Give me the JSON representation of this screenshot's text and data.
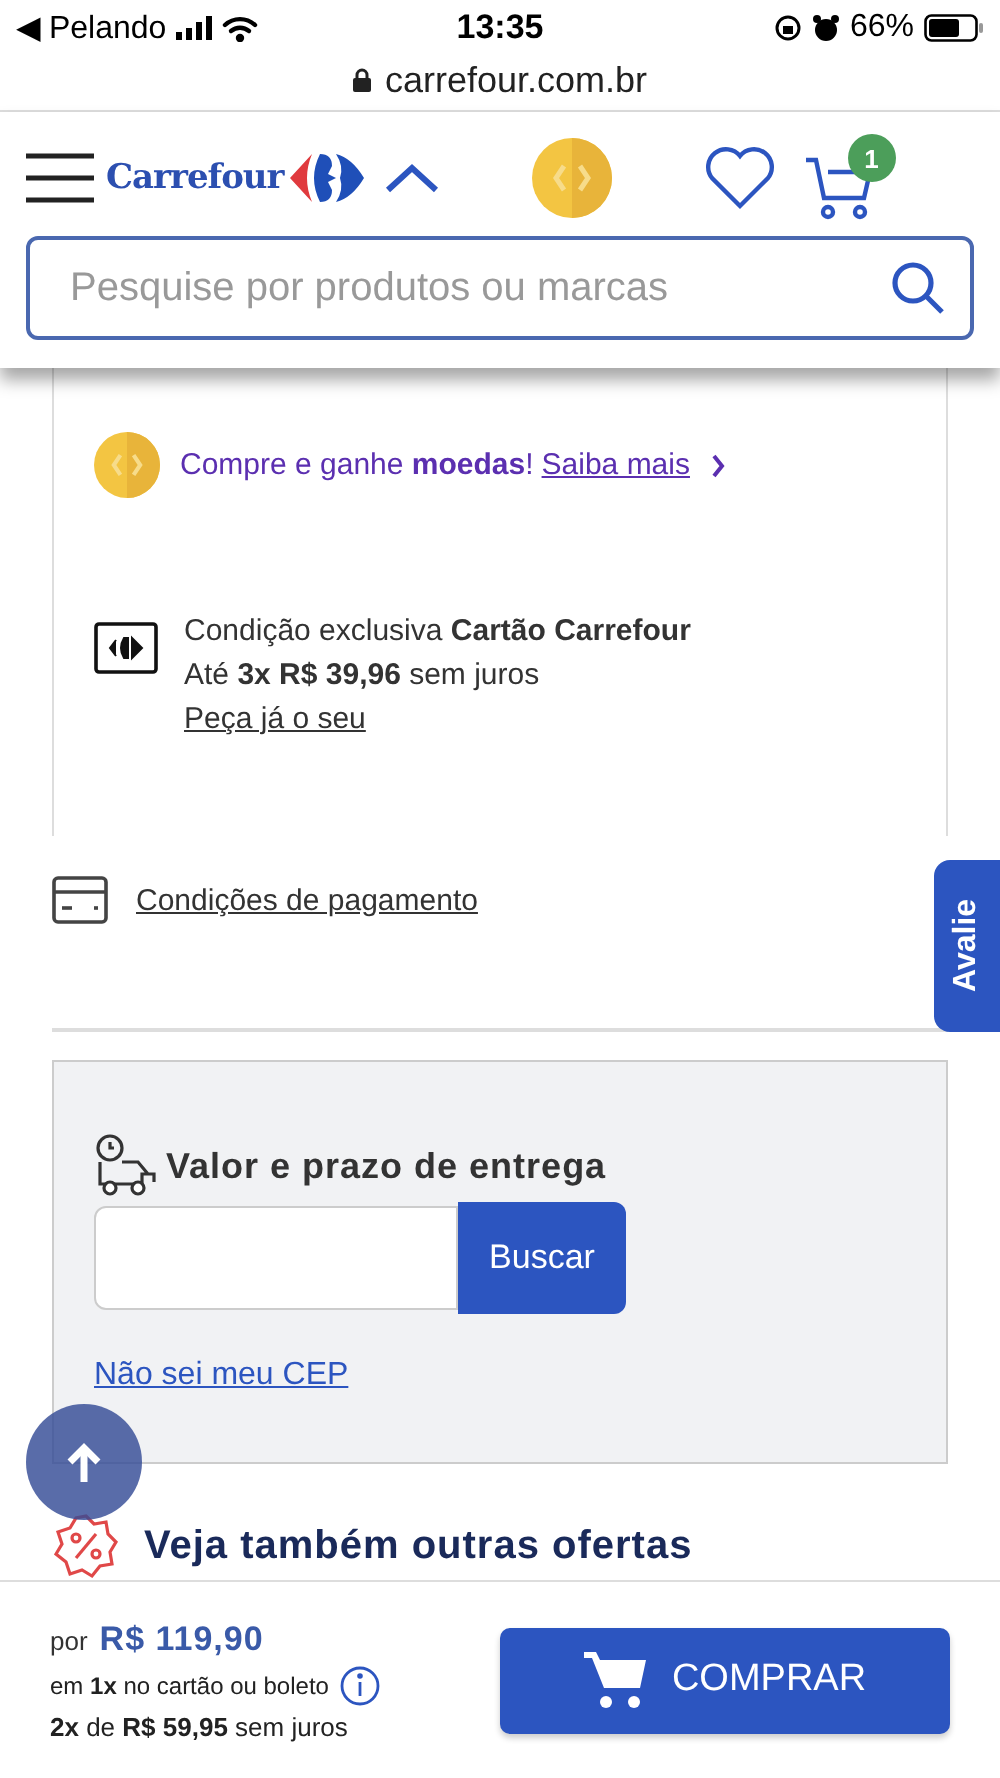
{
  "status_bar": {
    "back_app": "◀ Pelando",
    "time": "13:35",
    "battery": "66%"
  },
  "url_bar": {
    "url": "carrefour.com.br"
  },
  "header": {
    "logo": "Carrefour",
    "cart_count": "1"
  },
  "search": {
    "placeholder": "Pesquise por produtos ou marcas"
  },
  "coins": {
    "text": "Compre e ganhe **moedas**!",
    "link": "Saiba mais"
  },
  "card_offer": {
    "line_1": "Condição exclusiva **Cartão Carrefour**",
    "line_2": "Até **3x R$ 39,96** sem juros",
    "link": "Peça já o seu"
  },
  "payment": {
    "link": "Condições de pagamento"
  },
  "feedback_tab": {
    "label": "Avalie"
  },
  "delivery": {
    "title": "Valor e prazo de entrega",
    "button": "Buscar",
    "link": "Não sei meu CEP"
  },
  "offers": {
    "title": "Veja também outras ofertas"
  },
  "buy_bar": {
    "prefix": "por",
    "price": "R$ 119,90",
    "terms": "em **1x** no cartão ou boleto",
    "installments": "**2x** de **R$ 59,95** sem juros",
    "button": "COMPRAR"
  }
}
